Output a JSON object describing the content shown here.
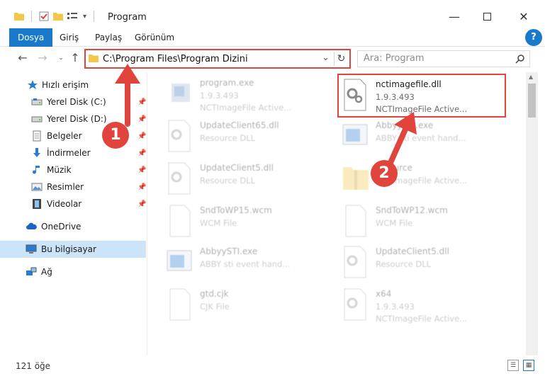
{
  "window": {
    "title": "Program"
  },
  "ribbon": {
    "tabs": [
      {
        "label": "Dosya",
        "active": true
      },
      {
        "label": "Giriş",
        "active": false
      },
      {
        "label": "Paylaş",
        "active": false
      },
      {
        "label": "Görünüm",
        "active": false
      }
    ],
    "help_label": "?"
  },
  "address": {
    "path": "C:\\Program Files\\Program Dizini",
    "dropdown_glyph": "⌄",
    "refresh_glyph": "↻"
  },
  "search": {
    "placeholder": "Ara: Program",
    "icon": "search-icon"
  },
  "nav": {
    "items": [
      {
        "label": "Hızlı erişim",
        "icon": "star-icon",
        "pinned": false,
        "selected": false
      },
      {
        "label": "Yerel Disk (C:)",
        "icon": "drive-icon",
        "pinned": true,
        "selected": false
      },
      {
        "label": "Yerel Disk (D:)",
        "icon": "drive-icon",
        "pinned": true,
        "selected": false
      },
      {
        "label": "Belgeler",
        "icon": "document-icon",
        "pinned": true,
        "selected": false
      },
      {
        "label": "İndirmeler",
        "icon": "download-arrow-icon",
        "pinned": true,
        "selected": false
      },
      {
        "label": "Müzik",
        "icon": "music-note-icon",
        "pinned": true,
        "selected": false
      },
      {
        "label": "Resimler",
        "icon": "picture-icon",
        "pinned": true,
        "selected": false
      },
      {
        "label": "Videolar",
        "icon": "film-icon",
        "pinned": true,
        "selected": false
      },
      {
        "label": "OneDrive",
        "icon": "cloud-icon",
        "pinned": false,
        "selected": false
      },
      {
        "label": "Bu bilgisayar",
        "icon": "computer-icon",
        "pinned": false,
        "selected": true
      },
      {
        "label": "Ağ",
        "icon": "network-icon",
        "pinned": false,
        "selected": false
      }
    ],
    "pin_glyph": "📌"
  },
  "files": [
    {
      "name": "program.exe",
      "line2": "1.9.3.493",
      "line3": "NCTImageFile Active...",
      "icon": "exe-icon",
      "faded": true,
      "highlight": false
    },
    {
      "name": "nctimagefile.dll",
      "line2": "1.9.3.493",
      "line3": "NCTImageFile Active...",
      "icon": "dll-gear-icon",
      "faded": false,
      "highlight": true
    },
    {
      "name": "UpdateClient65.dll",
      "line2": "Resource DLL",
      "line3": "",
      "icon": "dll-gear-icon",
      "faded": true,
      "highlight": false
    },
    {
      "name": "AbbyySTI.exe",
      "line2": "ABBY sti event hand...",
      "line3": "",
      "icon": "window-app-icon",
      "faded": true,
      "highlight": false
    },
    {
      "name": "UpdateClient5.dll",
      "line2": "Resource DLL",
      "line3": "",
      "icon": "dll-gear-icon",
      "faded": true,
      "highlight": false
    },
    {
      "name": "resource",
      "line2": "NCTImageFile Active...",
      "line3": "",
      "icon": "folder-zip-icon",
      "faded": true,
      "highlight": false
    },
    {
      "name": "SndToWP15.wcm",
      "line2": "WCM File",
      "line3": "",
      "icon": "blank-file-icon",
      "faded": true,
      "highlight": false
    },
    {
      "name": "SndToWP12.wcm",
      "line2": "WCM File",
      "line3": "",
      "icon": "blank-file-icon",
      "faded": true,
      "highlight": false
    },
    {
      "name": "AbbyySTI.exe",
      "line2": "ABBY sti event hand...",
      "line3": "",
      "icon": "window-app-icon",
      "faded": true,
      "highlight": false
    },
    {
      "name": "UpdateClient5.dll",
      "line2": "Resource DLL",
      "line3": "",
      "icon": "dll-gear-icon",
      "faded": true,
      "highlight": false
    },
    {
      "name": "gtd.cjk",
      "line2": "CJK File",
      "line3": "",
      "icon": "blank-file-icon",
      "faded": true,
      "highlight": false
    },
    {
      "name": "x64",
      "line2": "1.9.3.493",
      "line3": "NCTImageFile Active...",
      "icon": "dll-gear-icon",
      "faded": true,
      "highlight": false
    }
  ],
  "status": {
    "item_count": "121 öğe"
  },
  "annotations": {
    "step1": "1",
    "step2": "2",
    "color": "#e0443d"
  },
  "colors": {
    "accent": "#1979ca",
    "selection": "#cce4f7",
    "highlight_red": "#e0443d"
  }
}
